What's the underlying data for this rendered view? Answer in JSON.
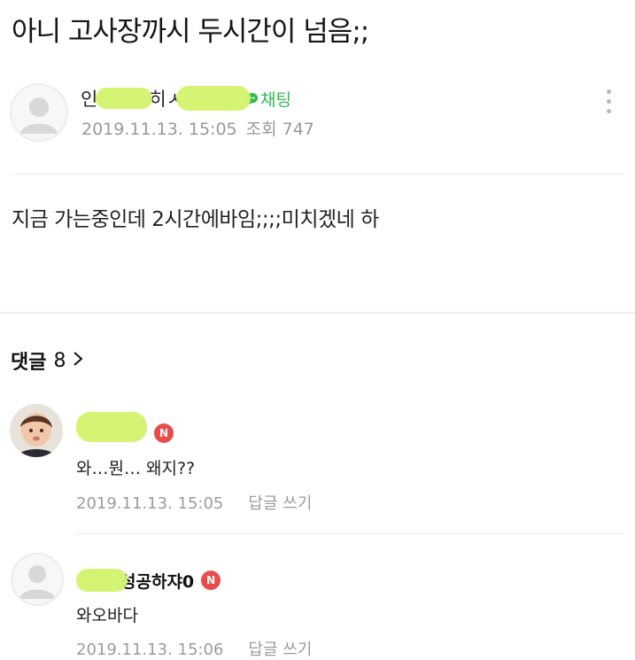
{
  "post": {
    "title": "아니 고사장까시 두시간이 넘음;;",
    "author": {
      "name_first": "인",
      "name_middle": "히",
      "name_tail": "ㅅ",
      "chat_label": "채팅"
    },
    "date": "2019.11.13. 15:05",
    "views_label": "조회 747",
    "body": "지금 가는중인데 2시간에바임;;;;미치겠네 하"
  },
  "comments_header": {
    "label": "댓글",
    "count": "8",
    "chevron": ">"
  },
  "comments": [
    {
      "name_visible": "",
      "badge": "N",
      "text": "와…뭔… 왜지??",
      "date": "2019.11.13. 15:05",
      "reply_label": "답글 쓰기"
    },
    {
      "name_visible": "성공하쟈0",
      "badge": "N",
      "text": "와오바다",
      "date": "2019.11.13. 15:06",
      "reply_label": "답글 쓰기"
    }
  ],
  "icons": {
    "more": "more-vertical-icon",
    "chat": "chat-bubble-icon",
    "chevron": "chevron-right-icon"
  },
  "colors": {
    "chat_green": "#2dbd4f",
    "badge_red": "#e94c4c",
    "redaction_highlight": "#d4f36d",
    "meta_gray": "#999999"
  }
}
